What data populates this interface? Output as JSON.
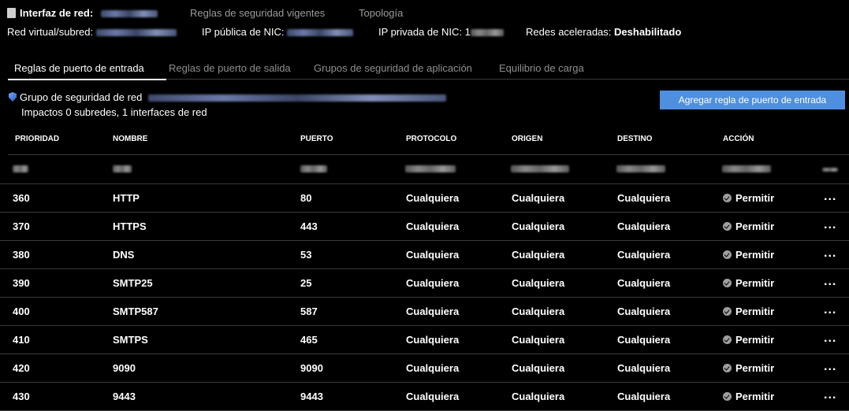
{
  "header": {
    "nic_label": "Interfaz de red:",
    "link_security_rules": "Reglas de seguridad vigentes",
    "link_topology": "Topología",
    "vnet_label": "Red virtual/subred:",
    "public_ip_label": "IP pública de NIC:",
    "private_ip_label": "IP privada de NIC:",
    "private_ip_prefix": "1",
    "accel_label": "Redes aceleradas:",
    "accel_value": "Deshabilitado"
  },
  "tabs": [
    {
      "label": "Reglas de puerto de entrada"
    },
    {
      "label": "Reglas de puerto de salida"
    },
    {
      "label": "Grupos de seguridad de aplicación"
    },
    {
      "label": "Equilibrio de carga"
    }
  ],
  "nsg": {
    "label": "Grupo de seguridad de red",
    "impact": "Impactos 0 subredes, 1 interfaces de red",
    "add_button": "Agregar regla de puerto de entrada"
  },
  "table": {
    "columns": [
      "PRIORIDAD",
      "NOMBRE",
      "PUERTO",
      "PROTOCOLO",
      "ORIGEN",
      "DESTINO",
      "ACCIÓN"
    ],
    "rows": [
      {
        "priority": "360",
        "name": "HTTP",
        "port": "80",
        "protocol": "Cualquiera",
        "source": "Cualquiera",
        "destination": "Cualquiera",
        "action": "Permitir"
      },
      {
        "priority": "370",
        "name": "HTTPS",
        "port": "443",
        "protocol": "Cualquiera",
        "source": "Cualquiera",
        "destination": "Cualquiera",
        "action": "Permitir"
      },
      {
        "priority": "380",
        "name": "DNS",
        "port": "53",
        "protocol": "Cualquiera",
        "source": "Cualquiera",
        "destination": "Cualquiera",
        "action": "Permitir"
      },
      {
        "priority": "390",
        "name": "SMTP25",
        "port": "25",
        "protocol": "Cualquiera",
        "source": "Cualquiera",
        "destination": "Cualquiera",
        "action": "Permitir"
      },
      {
        "priority": "400",
        "name": "SMTP587",
        "port": "587",
        "protocol": "Cualquiera",
        "source": "Cualquiera",
        "destination": "Cualquiera",
        "action": "Permitir"
      },
      {
        "priority": "410",
        "name": "SMTPS",
        "port": "465",
        "protocol": "Cualquiera",
        "source": "Cualquiera",
        "destination": "Cualquiera",
        "action": "Permitir"
      },
      {
        "priority": "420",
        "name": "9090",
        "port": "9090",
        "protocol": "Cualquiera",
        "source": "Cualquiera",
        "destination": "Cualquiera",
        "action": "Permitir"
      },
      {
        "priority": "430",
        "name": "9443",
        "port": "9443",
        "protocol": "Cualquiera",
        "source": "Cualquiera",
        "destination": "Cualquiera",
        "action": "Permitir"
      }
    ],
    "more_glyph": "..."
  },
  "colors": {
    "accent": "#4f8fe0",
    "background": "#000000",
    "divider": "#3a3a3a"
  }
}
